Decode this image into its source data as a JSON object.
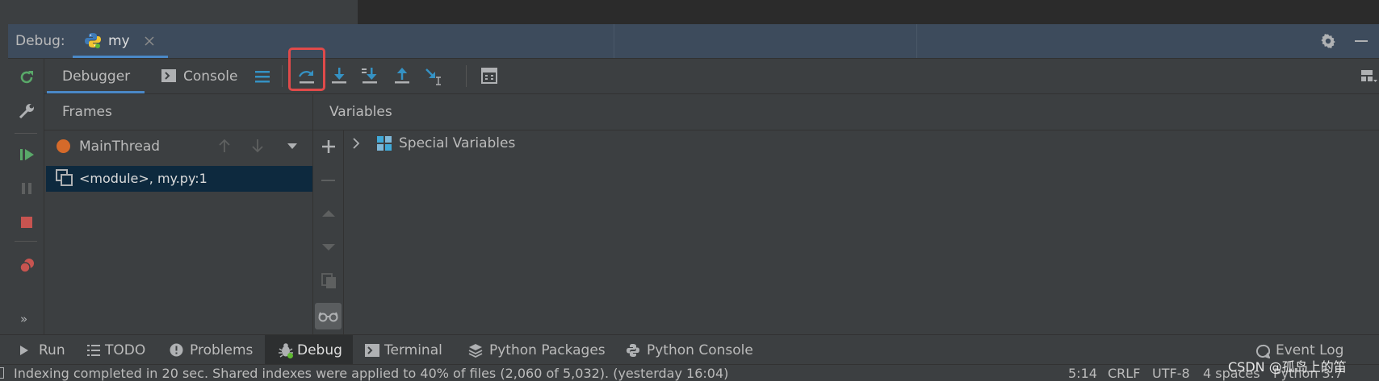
{
  "debug_header": {
    "label": "Debug:",
    "tab_name": "my"
  },
  "debugger_tabs": {
    "debugger": "Debugger",
    "console": "Console"
  },
  "frames": {
    "header": "Frames",
    "thread": "MainThread",
    "frame_row": "<module>, my.py:1"
  },
  "variables": {
    "header": "Variables",
    "special": "Special Variables"
  },
  "left_rail": {
    "more": "»"
  },
  "bottom_tabs": {
    "run": "Run",
    "todo": "TODO",
    "problems": "Problems",
    "debug": "Debug",
    "terminal": "Terminal",
    "python_packages": "Python Packages",
    "python_console": "Python Console",
    "event_log": "Event Log"
  },
  "status_bar": {
    "message": "Indexing completed in 20 sec. Shared indexes were applied to 40% of files (2,060 of 5,032). (yesterday 16:04)",
    "position": "5:14",
    "line_sep": "CRLF",
    "encoding": "UTF-8",
    "indent": "4 spaces",
    "interpreter": "Python 3.7"
  },
  "watermark": "CSDN @孤岛上的笛",
  "colors": {
    "panel_bg": "#3c3f41",
    "header_bg": "#3d4b5c",
    "editor_bg": "#2b2b2b",
    "accent_blue": "#4a88c7",
    "selected_row": "#0d293e",
    "highlight_box": "#e04a4a",
    "green": "#499c54",
    "red": "#c75450"
  }
}
